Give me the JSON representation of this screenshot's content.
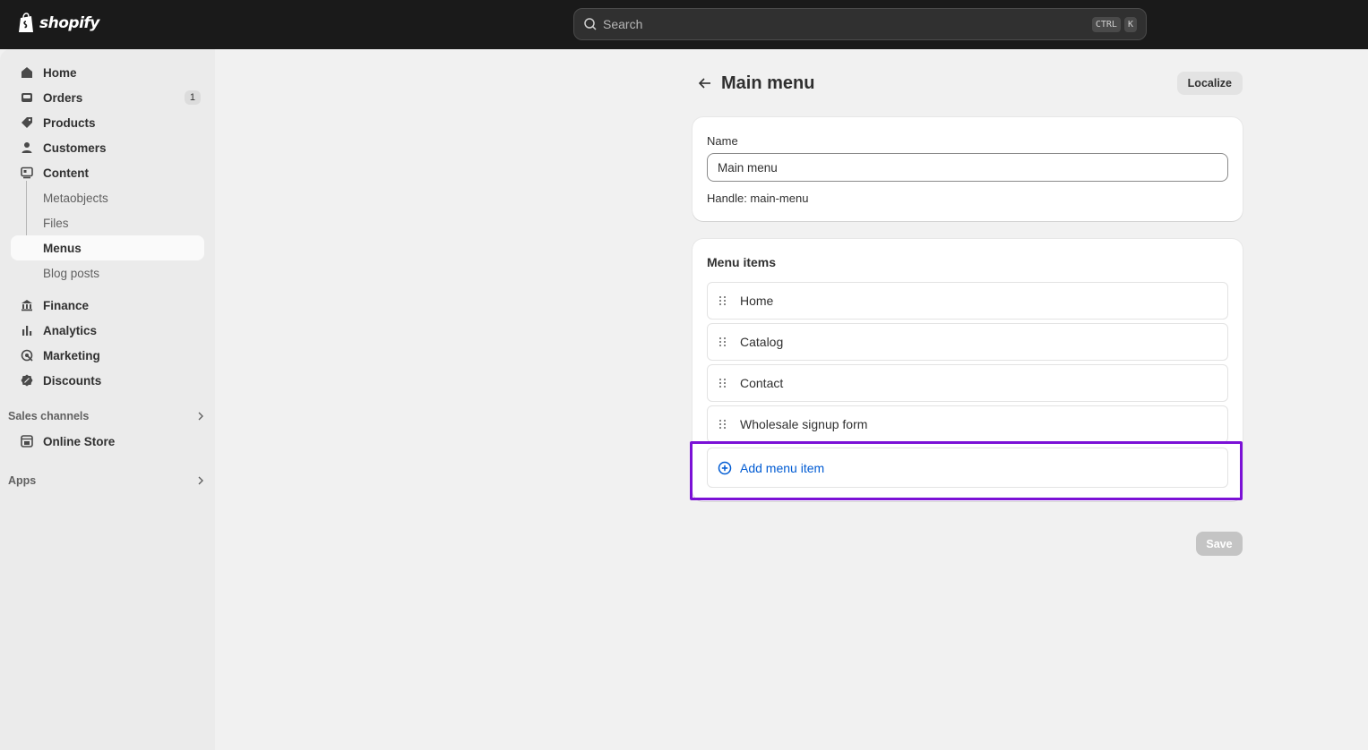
{
  "topbar": {
    "brand": "shopify",
    "search": {
      "placeholder": "Search",
      "shortcut_keys": [
        "CTRL",
        "K"
      ]
    }
  },
  "sidebar": {
    "items": [
      {
        "label": "Home",
        "icon": "home-icon"
      },
      {
        "label": "Orders",
        "icon": "inbox-icon",
        "badge": "1"
      },
      {
        "label": "Products",
        "icon": "tag-icon"
      },
      {
        "label": "Customers",
        "icon": "person-icon"
      },
      {
        "label": "Content",
        "icon": "content-icon"
      }
    ],
    "content_sub": [
      "Metaobjects",
      "Files",
      "Menus",
      "Blog posts"
    ],
    "active_sub": "Menus",
    "items2": [
      {
        "label": "Finance",
        "icon": "bank-icon"
      },
      {
        "label": "Analytics",
        "icon": "bar-chart-icon"
      },
      {
        "label": "Marketing",
        "icon": "target-icon"
      },
      {
        "label": "Discounts",
        "icon": "discount-icon"
      }
    ],
    "sales_channels": {
      "heading": "Sales channels",
      "items": [
        {
          "label": "Online Store",
          "icon": "store-icon"
        }
      ]
    },
    "apps": {
      "heading": "Apps"
    }
  },
  "page": {
    "title": "Main menu",
    "localize_label": "Localize",
    "name_card": {
      "label": "Name",
      "value": "Main menu",
      "handle": "Handle: main-menu"
    },
    "menu_items_card": {
      "title": "Menu items",
      "items": [
        "Home",
        "Catalog",
        "Contact",
        "Wholesale signup form"
      ],
      "add_label": "Add menu item"
    },
    "save_label": "Save"
  },
  "colors": {
    "topbar": "#1a1a1a",
    "accent_link": "#005bd3",
    "highlight": "#7b11d6",
    "save_disabled": "#c4c4c4"
  }
}
